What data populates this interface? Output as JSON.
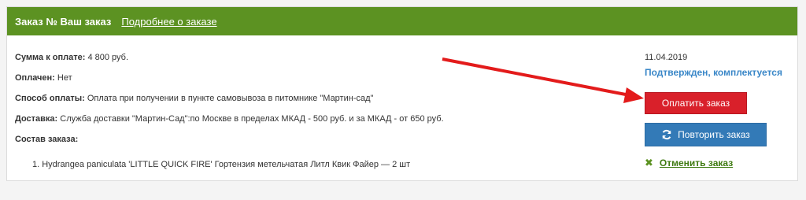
{
  "header": {
    "title": "Заказ № Ваш заказ",
    "details_link": "Подробнее о заказе"
  },
  "summary": {
    "sum_label": "Сумма к оплате:",
    "sum_value": " 4 800 руб.",
    "paid_label": "Оплачен:",
    "paid_value": " Нет",
    "payment_label": "Способ оплаты:",
    "payment_value": " Оплата при получении в пункте самовывоза в питомнике \"Мартин-сад\"",
    "delivery_label": "Доставка:",
    "delivery_value": " Служба доставки \"Мартин-Сад\":по Москве в пределах МКАД - 500 руб. и за МКАД - от 650 руб.",
    "composition_label": "Состав заказа:"
  },
  "items": [
    {
      "text": "1. Hydrangea paniculata 'LITTLE QUICK FIRE' Гортензия метельчатая Литл Квик Файер  — 2 шт"
    }
  ],
  "status_block": {
    "date": "11.04.2019",
    "status": "Подтвержден, комплектуется",
    "pay_button": "Оплатить заказ",
    "repeat_button": "Повторить заказ",
    "cancel_link": "Отменить заказ"
  },
  "icons": {
    "repeat": "refresh-icon",
    "cancel": "cross-icon",
    "annotation": "red-arrow"
  },
  "colors": {
    "header_bg": "#5c9222",
    "pay_button": "#d9202a",
    "repeat_button": "#337ab7",
    "status_text": "#3a87c8",
    "cancel_link": "#3e7a10",
    "annotation_arrow": "#e31b1b"
  }
}
